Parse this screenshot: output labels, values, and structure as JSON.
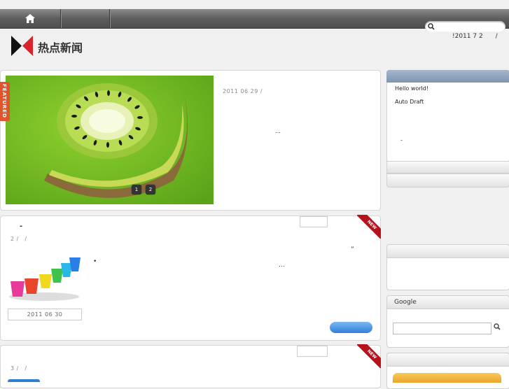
{
  "nav": {
    "home_icon": "home-icon",
    "search_icon": "search-icon"
  },
  "header": {
    "site_title": "热点新闻",
    "dateline": "!2011 7 2　　/"
  },
  "featured": {
    "tab_label": "FEATURED",
    "date": "2011 06 29 /",
    "excerpt_more": "…",
    "slides": [
      "1",
      "2"
    ]
  },
  "posts": [
    {
      "ribbon": "NEW",
      "title_mark": "-",
      "meta": "2 /　/",
      "quote_mark": "”",
      "excerpt_mark": "•",
      "excerpt_more": "…",
      "date": "2011 06 30"
    },
    {
      "ribbon": "NEW",
      "meta": "3 /　/"
    }
  ],
  "sidebar": {
    "recent": [
      "Hello world!",
      "Auto Draft"
    ],
    "comment_mark": "-",
    "google_title": "Google",
    "google_search_icon": "search-icon"
  },
  "colors": {
    "accent_orange": "#e2552c",
    "ribbon_red": "#b5121b",
    "button_blue": "#2f7fd8",
    "sidebar_header": "#8fa4bf"
  }
}
